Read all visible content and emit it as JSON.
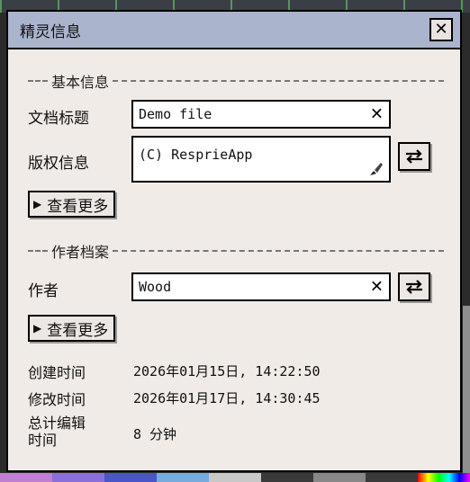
{
  "dialog": {
    "title": "精灵信息",
    "close_glyph": "✕"
  },
  "basic": {
    "heading": "基本信息",
    "doc_title_label": "文档标题",
    "doc_title_value": "Demo file",
    "copyright_label": "版权信息",
    "copyright_value": "(C) ResprieApp",
    "more_label": "查看更多"
  },
  "author_section": {
    "heading": "作者档案",
    "author_label": "作者",
    "author_value": "Wood",
    "more_label": "查看更多"
  },
  "meta": {
    "created_label": "创建时间",
    "created_value": "2026年01月15日, 14:22:50",
    "modified_label": "修改时间",
    "modified_value": "2026年01月17日, 14:30:45",
    "edit_time_label_1": "总计编辑",
    "edit_time_label_2": "时间",
    "edit_time_value": "8 分钟"
  },
  "colors": {
    "titlebar": "#aab4cc",
    "dialog_bg": "#f0ebe6"
  },
  "icons": {
    "clear": "close-icon",
    "swap": "swap-arrows-icon",
    "brush": "brush-icon",
    "expand": "triangle-right-icon"
  }
}
